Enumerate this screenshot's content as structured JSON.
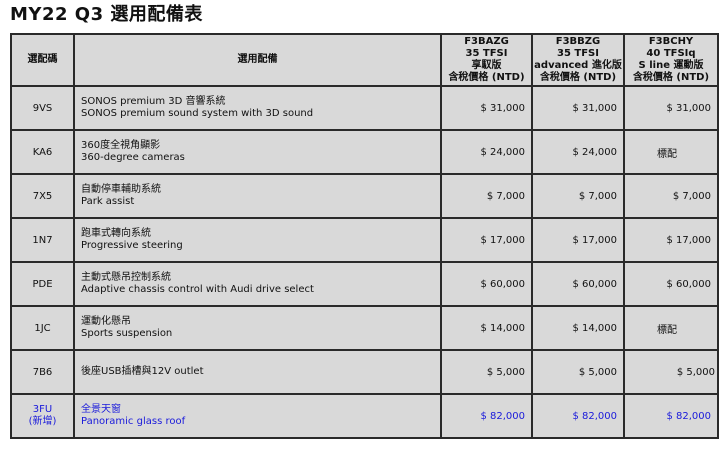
{
  "title": "MY22 Q3 選用配備表",
  "header": {
    "code_label": "選配碼",
    "feature_label": "選用配備",
    "variants": [
      {
        "lines": [
          "F3BAZG",
          "35 TFSI",
          "享馭版",
          "含稅價格 (NTD)"
        ]
      },
      {
        "lines": [
          "F3BBZG",
          "35 TFSI",
          "advanced 進化版",
          "含稅價格 (NTD)"
        ]
      },
      {
        "lines": [
          "F3BCHY",
          "40 TFSIq",
          "S line 運動版",
          "含稅價格 (NTD)"
        ]
      }
    ]
  },
  "rows": [
    {
      "code": "9VS",
      "zh": "SONOS premium 3D 音響系統",
      "en": "SONOS premium sound system with 3D sound",
      "prices": [
        "$ 31,000",
        "$ 31,000",
        "$ 31,000"
      ]
    },
    {
      "code": "KA6",
      "zh": "360度全視角顯影",
      "en": "360-degree cameras",
      "prices": [
        "$ 24,000",
        "$ 24,000",
        "標配"
      ]
    },
    {
      "code": "7X5",
      "zh": "自動停車輔助系統",
      "en": "Park assist",
      "prices": [
        "$ 7,000",
        "$ 7,000",
        "$ 7,000"
      ]
    },
    {
      "code": "1N7",
      "zh": "跑車式轉向系統",
      "en": "Progressive steering",
      "prices": [
        "$ 17,000",
        "$ 17,000",
        "$ 17,000"
      ]
    },
    {
      "code": "PDE",
      "zh": "主動式懸吊控制系統",
      "en": "Adaptive chassis control with Audi drive select",
      "prices": [
        "$ 60,000",
        "$ 60,000",
        "$ 60,000"
      ]
    },
    {
      "code": "1JC",
      "zh": "運動化懸吊",
      "en": "Sports suspension",
      "prices": [
        "$ 14,000",
        "$ 14,000",
        "標配"
      ]
    },
    {
      "code": "7B6",
      "zh": "後座USB插槽與12V outlet",
      "en": "",
      "prices": [
        "$ 5,000",
        "$ 5,000",
        "$ 5,000"
      ]
    },
    {
      "code": "3FU",
      "code_note": "(新增)",
      "zh": "全景天窗",
      "en": "Panoramic glass roof",
      "prices": [
        "$ 82,000",
        "$ 82,000",
        "$ 82,000"
      ],
      "highlight_color": "#1a1adb"
    }
  ]
}
